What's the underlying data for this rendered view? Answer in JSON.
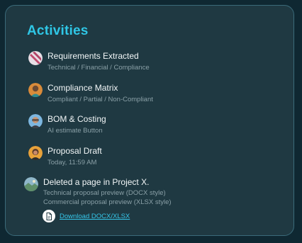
{
  "panel": {
    "title": "Activities"
  },
  "activities": [
    {
      "title": "Requirements Extracted",
      "subtitle": "Technical / Financial / Compliance",
      "avatar_icon": "striped-avatar-icon"
    },
    {
      "title": "Compliance Matrix",
      "subtitle": "Compliant / Partial / Non-Compliant",
      "avatar_icon": "person-avatar-icon"
    },
    {
      "title": "BOM & Costing",
      "subtitle": "AI estimate Button",
      "avatar_icon": "person-glasses-avatar-icon"
    },
    {
      "title": "Proposal Draft",
      "subtitle": "Today, 11:59 AM",
      "avatar_icon": "person-avatar-icon"
    }
  ],
  "last_activity": {
    "title": "Deleted a page in Project X.",
    "lines": [
      "Technical proposal preview (DOCX style)",
      "Commercial proposal preview (XLSX style)"
    ],
    "avatar_icon": "landscape-thumbnail-icon",
    "download_label": "Download DOCX/XLSX",
    "download_icon": "document-icon"
  },
  "colors": {
    "background": "#0f2832",
    "card": "#1f3942",
    "border": "#3b6b7a",
    "accent": "#2fc7e6",
    "link": "#35c5e8"
  }
}
